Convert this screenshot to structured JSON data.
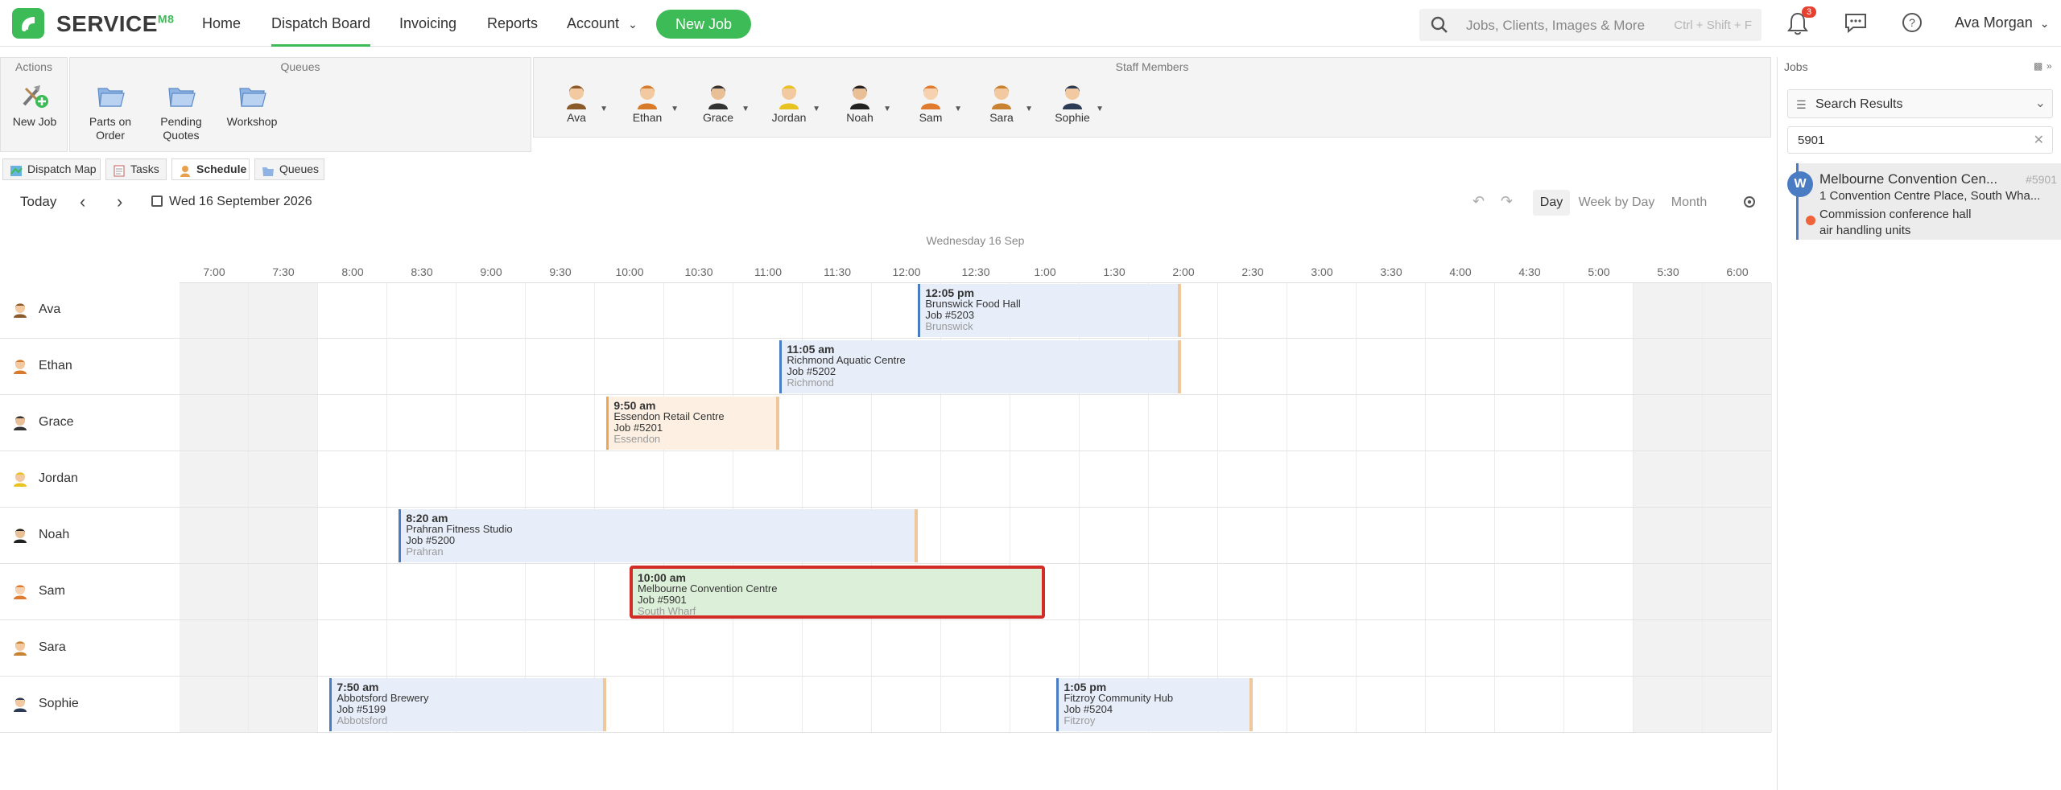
{
  "app": {
    "logo_text": "SERVICE",
    "logo_suffix": "M8"
  },
  "nav": {
    "items": [
      {
        "label": "Home"
      },
      {
        "label": "Dispatch Board"
      },
      {
        "label": "Invoicing"
      },
      {
        "label": "Reports"
      },
      {
        "label": "Account"
      }
    ],
    "new_job_label": "New Job"
  },
  "search": {
    "placeholder": "Jobs, Clients, Images & More",
    "shortcut": "Ctrl + Shift + F"
  },
  "notifications": {
    "count": "3"
  },
  "user": {
    "name": "Ava Morgan"
  },
  "toolbar": {
    "actions_header": "Actions",
    "queues_header": "Queues",
    "staff_header": "Staff Members",
    "actions": [
      {
        "label": "New Job"
      }
    ],
    "queues": [
      {
        "label": "Parts on Order"
      },
      {
        "label": "Pending Quotes"
      },
      {
        "label": "Workshop"
      }
    ],
    "staff": [
      {
        "label": "Ava"
      },
      {
        "label": "Ethan"
      },
      {
        "label": "Grace"
      },
      {
        "label": "Jordan"
      },
      {
        "label": "Noah"
      },
      {
        "label": "Sam"
      },
      {
        "label": "Sara"
      },
      {
        "label": "Sophie"
      }
    ]
  },
  "view_tabs": [
    {
      "label": "Dispatch Map"
    },
    {
      "label": "Tasks"
    },
    {
      "label": "Schedule"
    },
    {
      "label": "Queues"
    }
  ],
  "date_controls": {
    "today_label": "Today",
    "current_date": "Wed 16 September 2026",
    "views": [
      {
        "label": "Day"
      },
      {
        "label": "Week by Day"
      },
      {
        "label": "Month"
      }
    ]
  },
  "schedule": {
    "day_header": "Wednesday 16 Sep",
    "time_labels": [
      "7:00",
      "7:30",
      "8:00",
      "8:30",
      "9:00",
      "9:30",
      "10:00",
      "10:30",
      "11:00",
      "11:30",
      "12:00",
      "12:30",
      "1:00",
      "1:30",
      "2:00",
      "2:30",
      "3:00",
      "3:30",
      "4:00",
      "4:30",
      "5:00",
      "5:30",
      "6:00"
    ],
    "rows": [
      {
        "name": "Ava"
      },
      {
        "name": "Ethan"
      },
      {
        "name": "Grace"
      },
      {
        "name": "Jordan"
      },
      {
        "name": "Noah"
      },
      {
        "name": "Sam"
      },
      {
        "name": "Sara"
      },
      {
        "name": "Sophie"
      }
    ],
    "events": [
      {
        "time": "12:05 pm",
        "title": "Brunswick Food Hall",
        "job": "Job #5203",
        "suburb": "Brunswick"
      },
      {
        "time": "11:05 am",
        "title": "Richmond Aquatic Centre",
        "job": "Job #5202",
        "suburb": "Richmond"
      },
      {
        "time": "9:50 am",
        "title": "Essendon Retail Centre",
        "job": "Job #5201",
        "suburb": "Essendon"
      },
      {
        "time": "8:20 am",
        "title": "Prahran Fitness Studio",
        "job": "Job #5200",
        "suburb": "Prahran"
      },
      {
        "time": "10:00 am",
        "title": "Melbourne Convention Centre",
        "job": "Job #5901",
        "suburb": "South Wharf"
      },
      {
        "time": "7:50 am",
        "title": "Abbotsford Brewery",
        "job": "Job #5199",
        "suburb": "Abbotsford"
      },
      {
        "time": "1:05 pm",
        "title": "Fitzroy Community Hub",
        "job": "Job #5204",
        "suburb": "Fitzroy"
      }
    ]
  },
  "jobs_panel": {
    "header": "Jobs",
    "filter_label": "Search Results",
    "search_value": "5901",
    "results": [
      {
        "badge": "W",
        "title": "Melbourne Convention Cen...",
        "number": "#5901",
        "address": "1 Convention Centre Place, South Wha...",
        "description": "Commission conference hall air handling units"
      }
    ]
  }
}
